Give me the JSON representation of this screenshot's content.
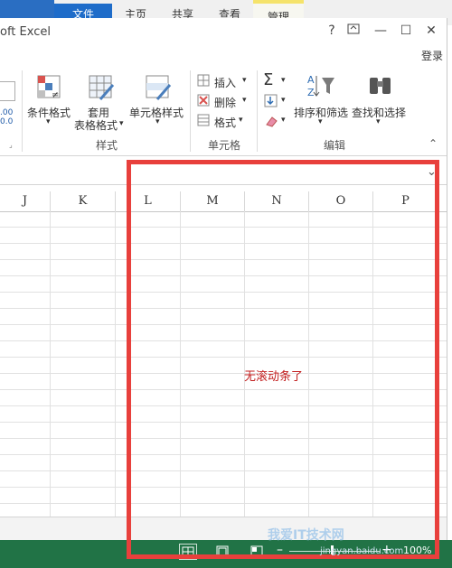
{
  "explorer": {
    "tabs": [
      "文件",
      "主页",
      "共享",
      "查看",
      "管理"
    ]
  },
  "window": {
    "title": "oft Excel",
    "help_label": "?",
    "minimize_label": "—",
    "maximize_label": "☐",
    "close_label": "✕",
    "login_label": "登录"
  },
  "ribbon": {
    "partial_value": ".00\n0.0",
    "conditional_format_label": "条件格式",
    "table_format_label_1": "套用",
    "table_format_label_2": "表格格式",
    "cell_style_label": "单元格样式",
    "styles_group_label": "样式",
    "insert_label": "插入",
    "delete_label": "删除",
    "format_label": "格式",
    "cells_group_label": "单元格",
    "sort_filter_label": "排序和筛选",
    "find_select_label": "查找和选择",
    "editing_group_label": "编辑"
  },
  "grid": {
    "columns": [
      "J",
      "K",
      "L",
      "M",
      "N",
      "O",
      "P"
    ]
  },
  "annotation": {
    "text": "无滚动条了"
  },
  "status": {
    "zoom": "100%"
  },
  "watermark": {
    "text": "我爱IT技术网",
    "subtext": "jingyan.baidu.com"
  }
}
